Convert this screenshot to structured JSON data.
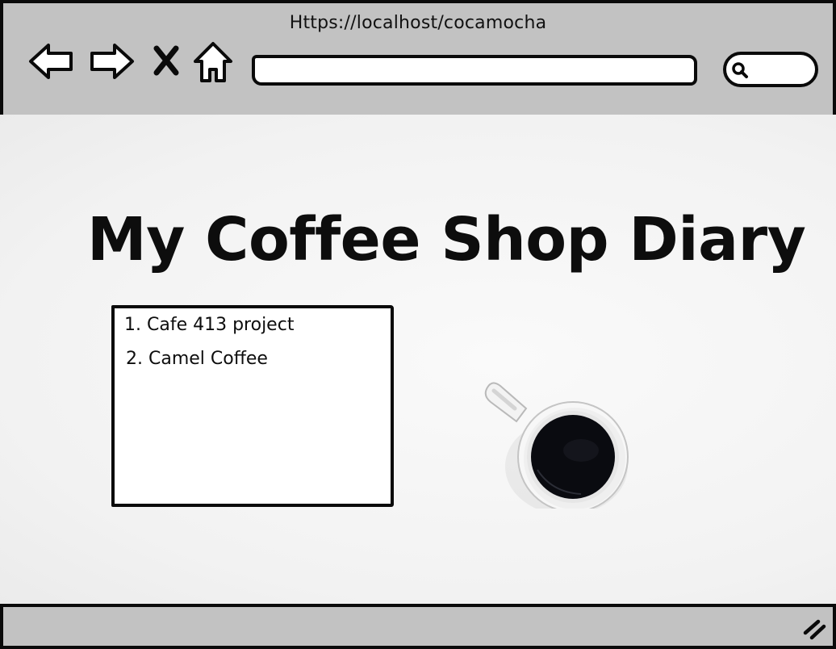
{
  "browser": {
    "url": "Https://localhost/cocamocha",
    "nav_icons": [
      "back-arrow-icon",
      "forward-arrow-icon",
      "close-x-icon",
      "home-icon"
    ],
    "address_value": "",
    "search_icon": "search-icon",
    "resize_icon": "resize-grip-icon"
  },
  "page": {
    "title": "My Coffee Shop Diary",
    "list": [
      "1. Cafe 413 project",
      "2. Camel Coffee"
    ],
    "image": "coffee-cup-top-view"
  },
  "colors": {
    "chrome": "#c2c2c2",
    "ink": "#0a0a0a",
    "background": "#f4f4f4"
  }
}
